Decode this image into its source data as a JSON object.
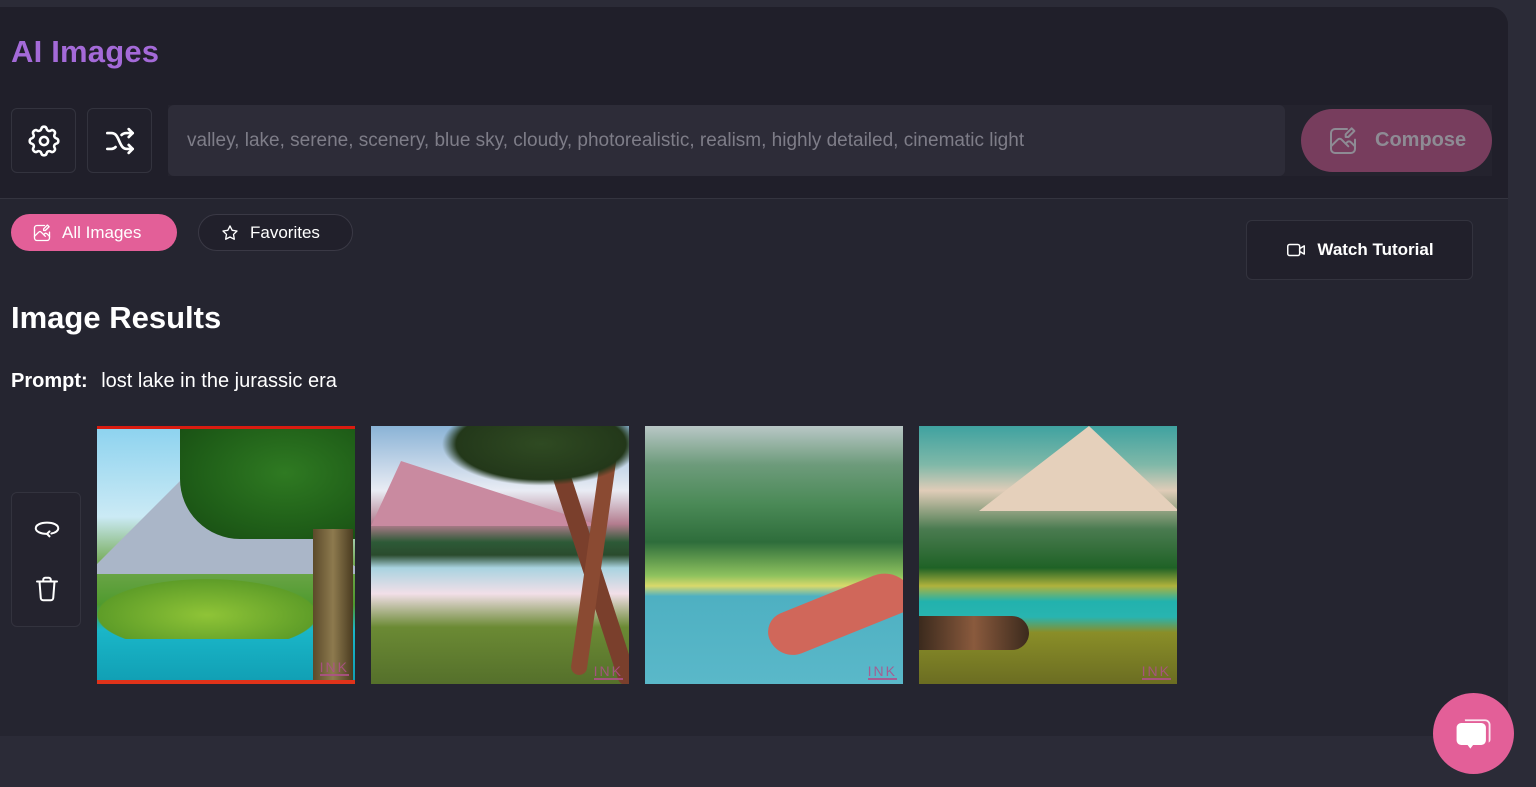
{
  "app": {
    "title": "AI Images"
  },
  "toolbar": {
    "settings_icon": "gear-icon",
    "shuffle_icon": "shuffle-icon",
    "prompt_placeholder": "valley, lake, serene, scenery, blue sky, cloudy, photorealistic, realism, highly detailed, cinematic light",
    "prompt_value": "",
    "compose_label": "Compose",
    "compose_icon": "image-edit-icon"
  },
  "filters": {
    "tabs": [
      {
        "label": "All Images",
        "icon": "image-edit-icon",
        "active": true
      },
      {
        "label": "Favorites",
        "icon": "star-icon",
        "active": false
      }
    ],
    "tutorial_label": "Watch Tutorial",
    "tutorial_icon": "video-camera-icon"
  },
  "results": {
    "heading": "Image Results",
    "prompt_label": "Prompt:",
    "prompt_text": "lost lake in the jurassic era",
    "actions": [
      {
        "name": "regenerate",
        "icon": "refresh-loop-icon"
      },
      {
        "name": "delete",
        "icon": "trash-icon"
      }
    ],
    "images": [
      {
        "alt": "Mountain lake with tree and long-necked dinosaur",
        "watermark": "INK"
      },
      {
        "alt": "Lake with palm trees and mountain",
        "watermark": "INK"
      },
      {
        "alt": "Valley lake with dinosaur in water",
        "watermark": "INK"
      },
      {
        "alt": "Mountain lake with forest and creature on grass",
        "watermark": "INK"
      }
    ]
  },
  "chat": {
    "icon": "chat-bubbles-icon"
  },
  "colors": {
    "accent_pink": "#e35f98",
    "title_purple": "#a46ad8",
    "compose_disabled": "#773d5d",
    "background": "#252530"
  }
}
